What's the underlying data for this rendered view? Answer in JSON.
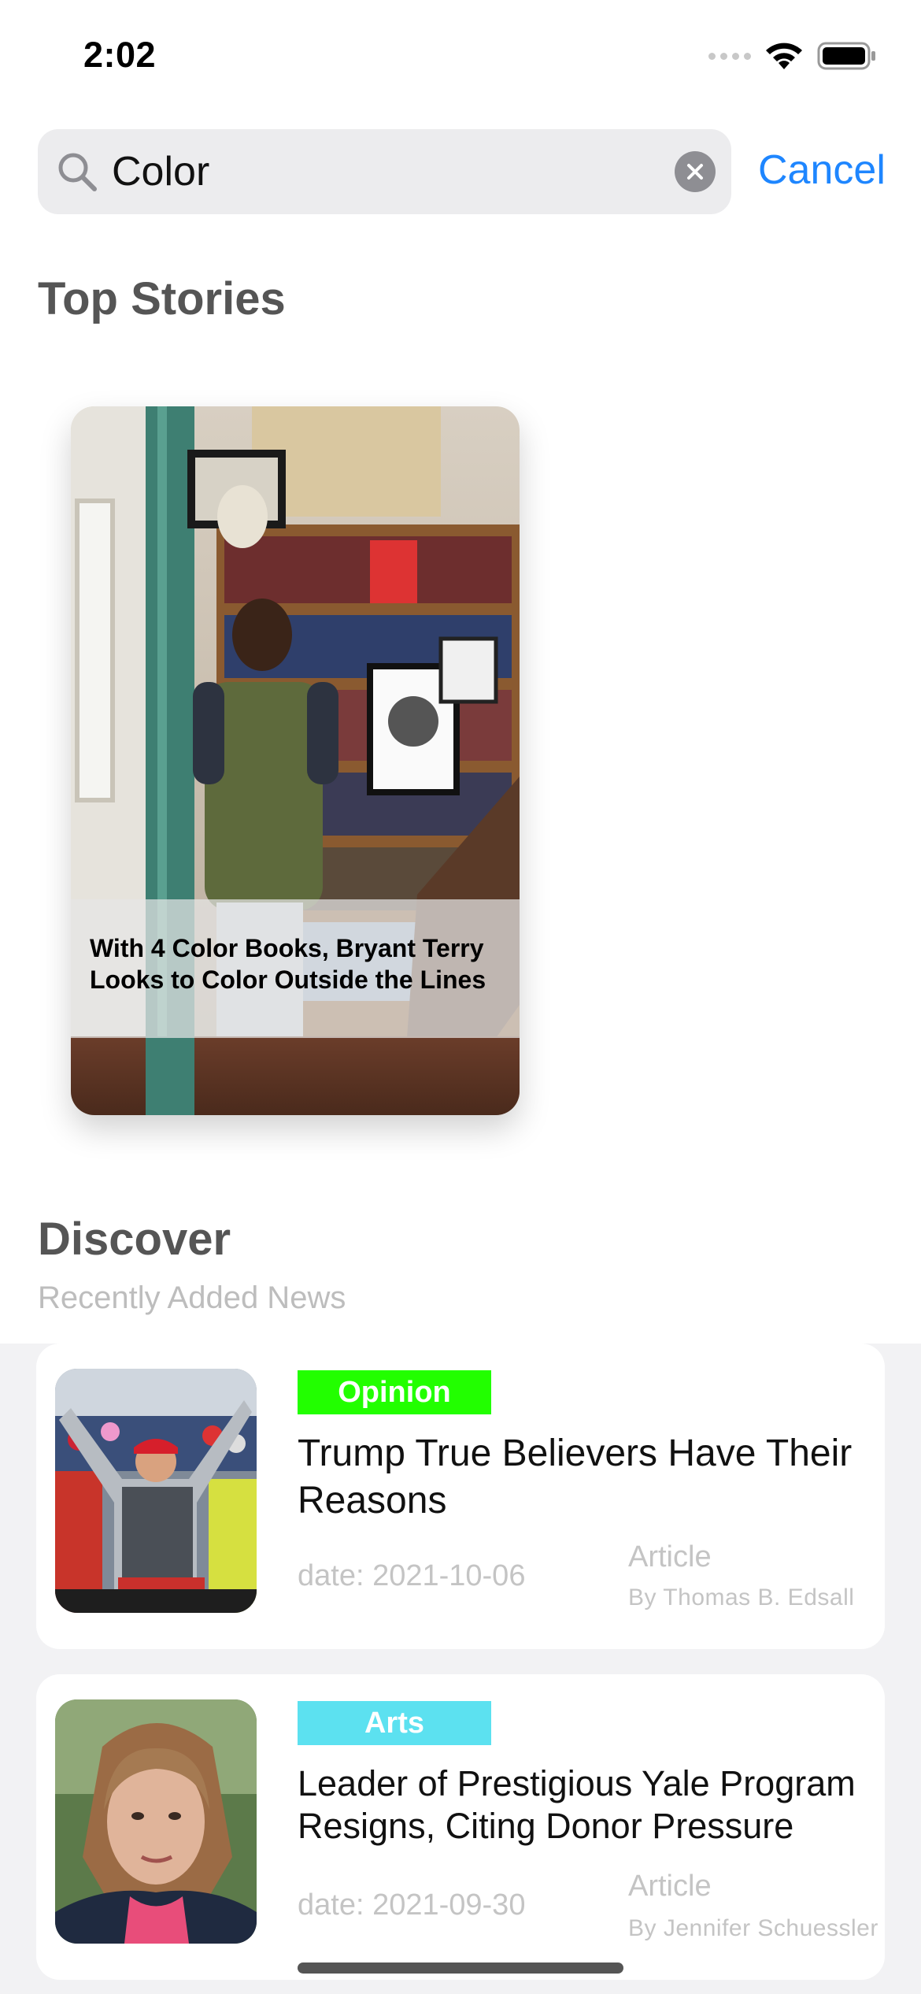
{
  "status_bar": {
    "time": "2:02"
  },
  "search": {
    "query": "Color",
    "cancel_label": "Cancel"
  },
  "top_stories": {
    "heading": "Top Stories",
    "cards": [
      {
        "title": "With 4 Color Books, Bryant Terry Looks to Color Outside the Lines"
      }
    ]
  },
  "discover": {
    "heading": "Discover",
    "subheading": "Recently Added News",
    "items": [
      {
        "tag": "Opinion",
        "tag_color": "#22ff00",
        "title": "Trump True Believers Have Their Reasons",
        "date": "date: 2021-10-06",
        "type": "Article",
        "author": "By Thomas B. Edsall"
      },
      {
        "tag": "Arts",
        "tag_color": "#5ce1f0",
        "title": "Leader of Prestigious Yale Program Resigns, Citing Donor Pressure",
        "date": "date: 2021-09-30",
        "type": "Article",
        "author": "By Jennifer Schuessler"
      }
    ]
  },
  "colors": {
    "accent": "#1e86ff",
    "search_bg": "#ececee"
  }
}
